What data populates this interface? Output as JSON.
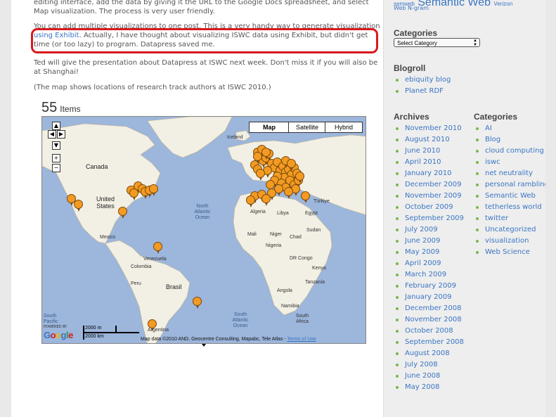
{
  "post": {
    "para1": "editing interface, add the data by giving it the URL to the Google Docs spreadsheet, and select Map visualization. The process is very user friendly.",
    "para2_lead": "You can add multiple visualizations to one post. This is a very handy way to generate visualization",
    "para2_link": "using Exhibit",
    "para2_rest": ". Actually, I have thought about visualizing ISWC data using Exhibit, but didn't get time (or too lazy) to program. Datapress saved me.",
    "para3": "Ted will give the presentation about Datapress at ISWC next week. Don't miss it if you will also be at Shanghai!",
    "para4": "(The map shows locations of research track authors at ISWC 2010.)",
    "items_count": "55",
    "items_label": "Items"
  },
  "map": {
    "type_buttons": [
      "Map",
      "Satellite",
      "Hybrid"
    ],
    "selected_type": "Map",
    "nav_buttons": [
      "▲",
      "◀",
      "▶",
      "▼",
      "+",
      "−"
    ],
    "labels": {
      "canada": "Canada",
      "united_states": "United States",
      "mexico": "Mexico",
      "venezuela": "Venezuela",
      "colombia": "Colombia",
      "peru": "Peru",
      "brasil": "Brasil",
      "iceland": "Iceland",
      "north_atlantic": "North Atlantic Ocean",
      "south_atlantic": "South Atlantic Ocean",
      "south_pacific": "South Pacific",
      "algeria": "Algeria",
      "libya": "Libya",
      "egypt": "Egypt",
      "mali": "Mali",
      "niger": "Niger",
      "sudan": "Sudan",
      "chad": "Chad",
      "nigeria": "Nigeria",
      "dr_congo": "DR Congo",
      "kenya": "Kenya",
      "tanzania": "Tanzania",
      "angola": "Angola",
      "namibia": "Namibia",
      "south_africa": "South Africa",
      "turkiye": "Türkiye",
      "argentina": "Argentina"
    },
    "scale_metric": "2000 m",
    "scale_km": "2000 km",
    "google": "Google",
    "powered_by": "POWERED BY",
    "attribution": "Map data ©2010 AND, Geocentre Consulting, Mapabc, Tele Atlas -",
    "terms": "Terms of Use"
  },
  "sidebar": {
    "header_prefix": "semweb",
    "header_title": "Semantic Web",
    "header_suffix": "Verizon",
    "header_sub": "Web N-gram",
    "categories_title": "Categories",
    "select_label": "Select Category",
    "blogroll_title": "Blogroll",
    "blogroll": [
      "ebiquity blog",
      "Planet RDF"
    ],
    "archives_title": "Archives",
    "archives": [
      "November 2010",
      "August 2010",
      "June 2010",
      "April 2010",
      "January 2010",
      "December 2009",
      "November 2009",
      "October 2009",
      "September 2009",
      "July 2009",
      "June 2009",
      "May 2009",
      "April 2009",
      "March 2009",
      "February 2009",
      "January 2009",
      "December 2008",
      "November 2008",
      "October 2008",
      "September 2008",
      "August 2008",
      "July 2008",
      "June 2008",
      "May 2008"
    ],
    "categories2_title": "Categories",
    "categories2": [
      "AI",
      "Blog",
      "cloud computing",
      "iswc",
      "net neutrality",
      "personal ramblings",
      "Semantic Web",
      "tetherless world",
      "twitter",
      "Uncategorized",
      "visualization",
      "Web Science"
    ]
  },
  "colors": {
    "link": "#3a75c4",
    "highlight_border": "#d8191d",
    "pin": "#f39a22",
    "bullet": "#7ab648",
    "ocean": "#9cb6dc",
    "land": "#f2efe5"
  }
}
